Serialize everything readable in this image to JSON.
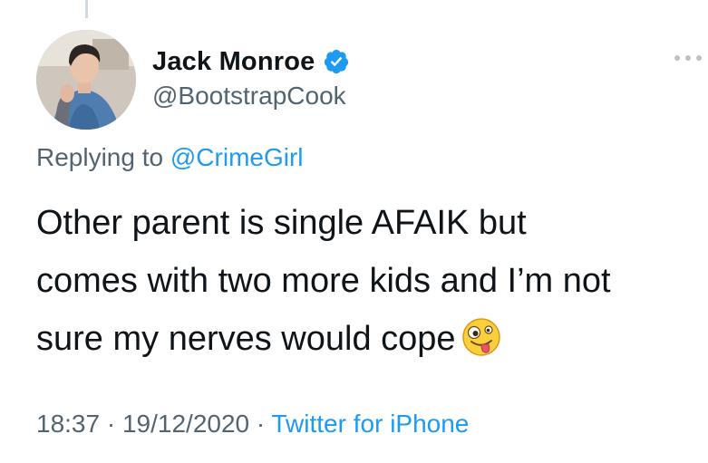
{
  "tweet": {
    "author": {
      "display_name": "Jack Monroe",
      "handle": "@BootstrapCook",
      "verified": true,
      "avatar_icon": "profile-photo"
    },
    "reply": {
      "prefix": "Replying to",
      "mention": "@CrimeGirl"
    },
    "text_lines": [
      "Other parent is single AFAIK but",
      "comes with two more kids and I’m not",
      "sure my nerves would cope"
    ],
    "emoji_icon": "zany-face-emoji",
    "meta": {
      "time": "18:37",
      "separator": " · ",
      "date": "19/12/2020",
      "source": "Twitter for iPhone"
    }
  },
  "colors": {
    "text_primary": "#0f1419",
    "text_secondary": "#536471",
    "accent": "#1d9bf0",
    "verified_badge": "#1d9bf0"
  }
}
